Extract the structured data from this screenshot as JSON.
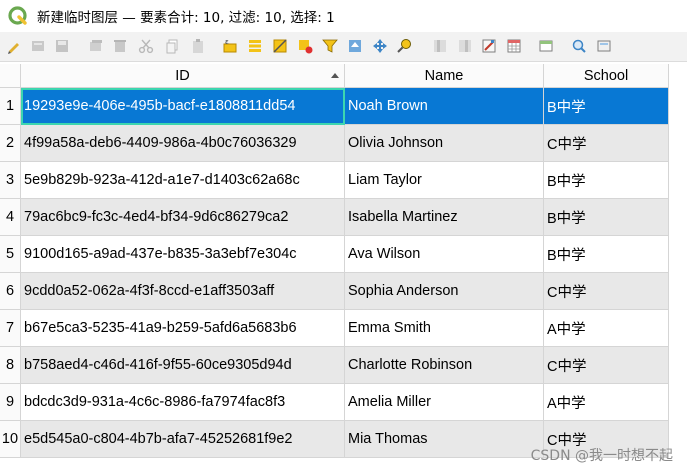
{
  "window": {
    "title": "新建临时图层 — 要素合计: 10, 过滤: 10, 选择: 1"
  },
  "toolbar": {
    "buttons": [
      "toggle-editing-icon",
      "multi-edit-icon",
      "save-edits-icon",
      "reload-icon",
      "add-feature-icon",
      "delete-feature-icon",
      "cut-icon",
      "copy-icon",
      "paste-icon",
      "select-by-expression-icon",
      "select-all-icon",
      "invert-selection-icon",
      "deselect-all-icon",
      "filter-select-icon",
      "move-selection-top-icon",
      "pan-to-selected-icon",
      "zoom-to-selected-icon",
      "new-field-icon",
      "delete-field-icon",
      "open-field-calculator-icon",
      "conditional-formatting-icon",
      "dock-table-icon",
      "actions-icon"
    ]
  },
  "table": {
    "columns": [
      "ID",
      "Name",
      "School"
    ],
    "rows": [
      {
        "num": "1",
        "id": "19293e9e-406e-495b-bacf-e1808811dd54",
        "name": "Noah Brown",
        "school": "B中学"
      },
      {
        "num": "2",
        "id": "4f99a58a-deb6-4409-986a-4b0c76036329",
        "name": "Olivia Johnson",
        "school": "C中学"
      },
      {
        "num": "3",
        "id": "5e9b829b-923a-412d-a1e7-d1403c62a68c",
        "name": "Liam Taylor",
        "school": "B中学"
      },
      {
        "num": "4",
        "id": "79ac6bc9-fc3c-4ed4-bf34-9d6c86279ca2",
        "name": "Isabella Martinez",
        "school": "B中学"
      },
      {
        "num": "5",
        "id": "9100d165-a9ad-437e-b835-3a3ebf7e304c",
        "name": "Ava Wilson",
        "school": "B中学"
      },
      {
        "num": "6",
        "id": "9cdd0a52-062a-4f3f-8ccd-e1aff3503aff",
        "name": "Sophia Anderson",
        "school": "C中学"
      },
      {
        "num": "7",
        "id": "b67e5ca3-5235-41a9-b259-5afd6a5683b6",
        "name": "Emma Smith",
        "school": "A中学"
      },
      {
        "num": "8",
        "id": "b758aed4-c46d-416f-9f55-60ce9305d94d",
        "name": "Charlotte Robinson",
        "school": "C中学"
      },
      {
        "num": "9",
        "id": "bdcdc3d9-931a-4c6c-8986-fa7974fac8f3",
        "name": "Amelia Miller",
        "school": "A中学"
      },
      {
        "num": "10",
        "id": "e5d545a0-c804-4b7b-afa7-45252681f9e2",
        "name": "Mia Thomas",
        "school": "C中学"
      }
    ]
  },
  "watermark": "CSDN @我一时想不起"
}
